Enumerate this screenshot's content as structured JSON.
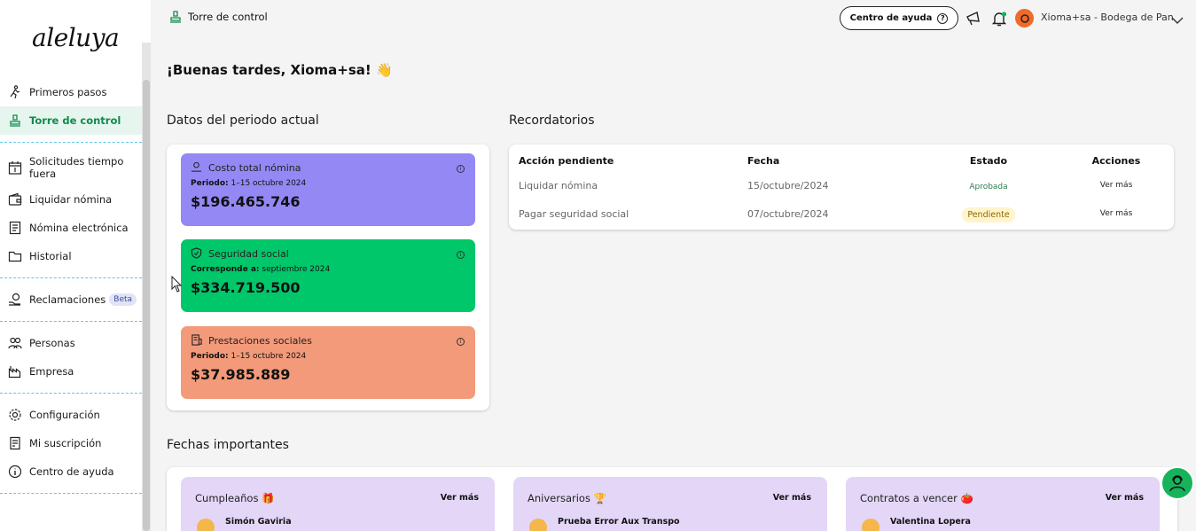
{
  "brand": {
    "logo": "aleluya"
  },
  "topbar": {
    "title": "Torre de control",
    "help_label": "Centro de ayuda",
    "user_label": "Xioma+sa - Bodega de Pan"
  },
  "sidebar": {
    "items": [
      {
        "label": "Primeros pasos",
        "icon": "runner-icon"
      },
      {
        "label": "Torre de control",
        "icon": "stamp-icon",
        "active": true
      },
      {
        "label": "Solicitudes tiempo fuera",
        "icon": "calendar-icon"
      },
      {
        "label": "Liquidar nómina",
        "icon": "wallet-icon"
      },
      {
        "label": "Nómina electrónica",
        "icon": "document-icon"
      },
      {
        "label": "Historial",
        "icon": "folder-icon"
      },
      {
        "label": "Reclamaciones",
        "icon": "hand-money-icon",
        "badge": "Beta"
      },
      {
        "label": "Personas",
        "icon": "people-icon"
      },
      {
        "label": "Empresa",
        "icon": "factory-icon"
      },
      {
        "label": "Configuración",
        "icon": "gear-icon"
      },
      {
        "label": "Mi suscripción",
        "icon": "receipt-icon"
      },
      {
        "label": "Centro de ayuda",
        "icon": "info-icon"
      }
    ]
  },
  "greeting": "¡Buenas tardes, Xioma+sa! 👋",
  "period": {
    "title": "Datos del periodo actual",
    "cards": [
      {
        "title": "Costo total nómina",
        "sub_label": "Periodo:",
        "sub_value": "1–15 octubre 2024",
        "amount": "$196.465.746",
        "color": "#9488f5"
      },
      {
        "title": "Seguridad social",
        "sub_label": "Corresponde a:",
        "sub_value": "septiembre 2024",
        "amount": "$334.719.500",
        "color": "#00c76a"
      },
      {
        "title": "Prestaciones sociales",
        "sub_label": "Periodo:",
        "sub_value": "1–15 octubre 2024",
        "amount": "$37.985.889",
        "color": "#f39a7a"
      }
    ]
  },
  "reminders": {
    "title": "Recordatorios",
    "columns": [
      "Acción pendiente",
      "Fecha",
      "Estado",
      "Acciones"
    ],
    "rows": [
      {
        "action": "Liquidar nómina",
        "date": "15/octubre/2024",
        "status": "Aprobada",
        "link": "Ver más"
      },
      {
        "action": "Pagar seguridad social",
        "date": "07/octubre/2024",
        "status": "Pendiente",
        "link": "Ver más"
      }
    ]
  },
  "dates": {
    "title": "Fechas importantes",
    "cards": [
      {
        "title": "Cumpleaños 🎁",
        "link": "Ver más",
        "person": "Simón Gaviria"
      },
      {
        "title": "Aniversarios 🏆",
        "link": "Ver más",
        "person": "Prueba Error Aux Transpo"
      },
      {
        "title": "Contratos a vencer 🍅",
        "link": "Ver más",
        "person": "Valentina Lopera"
      }
    ]
  }
}
